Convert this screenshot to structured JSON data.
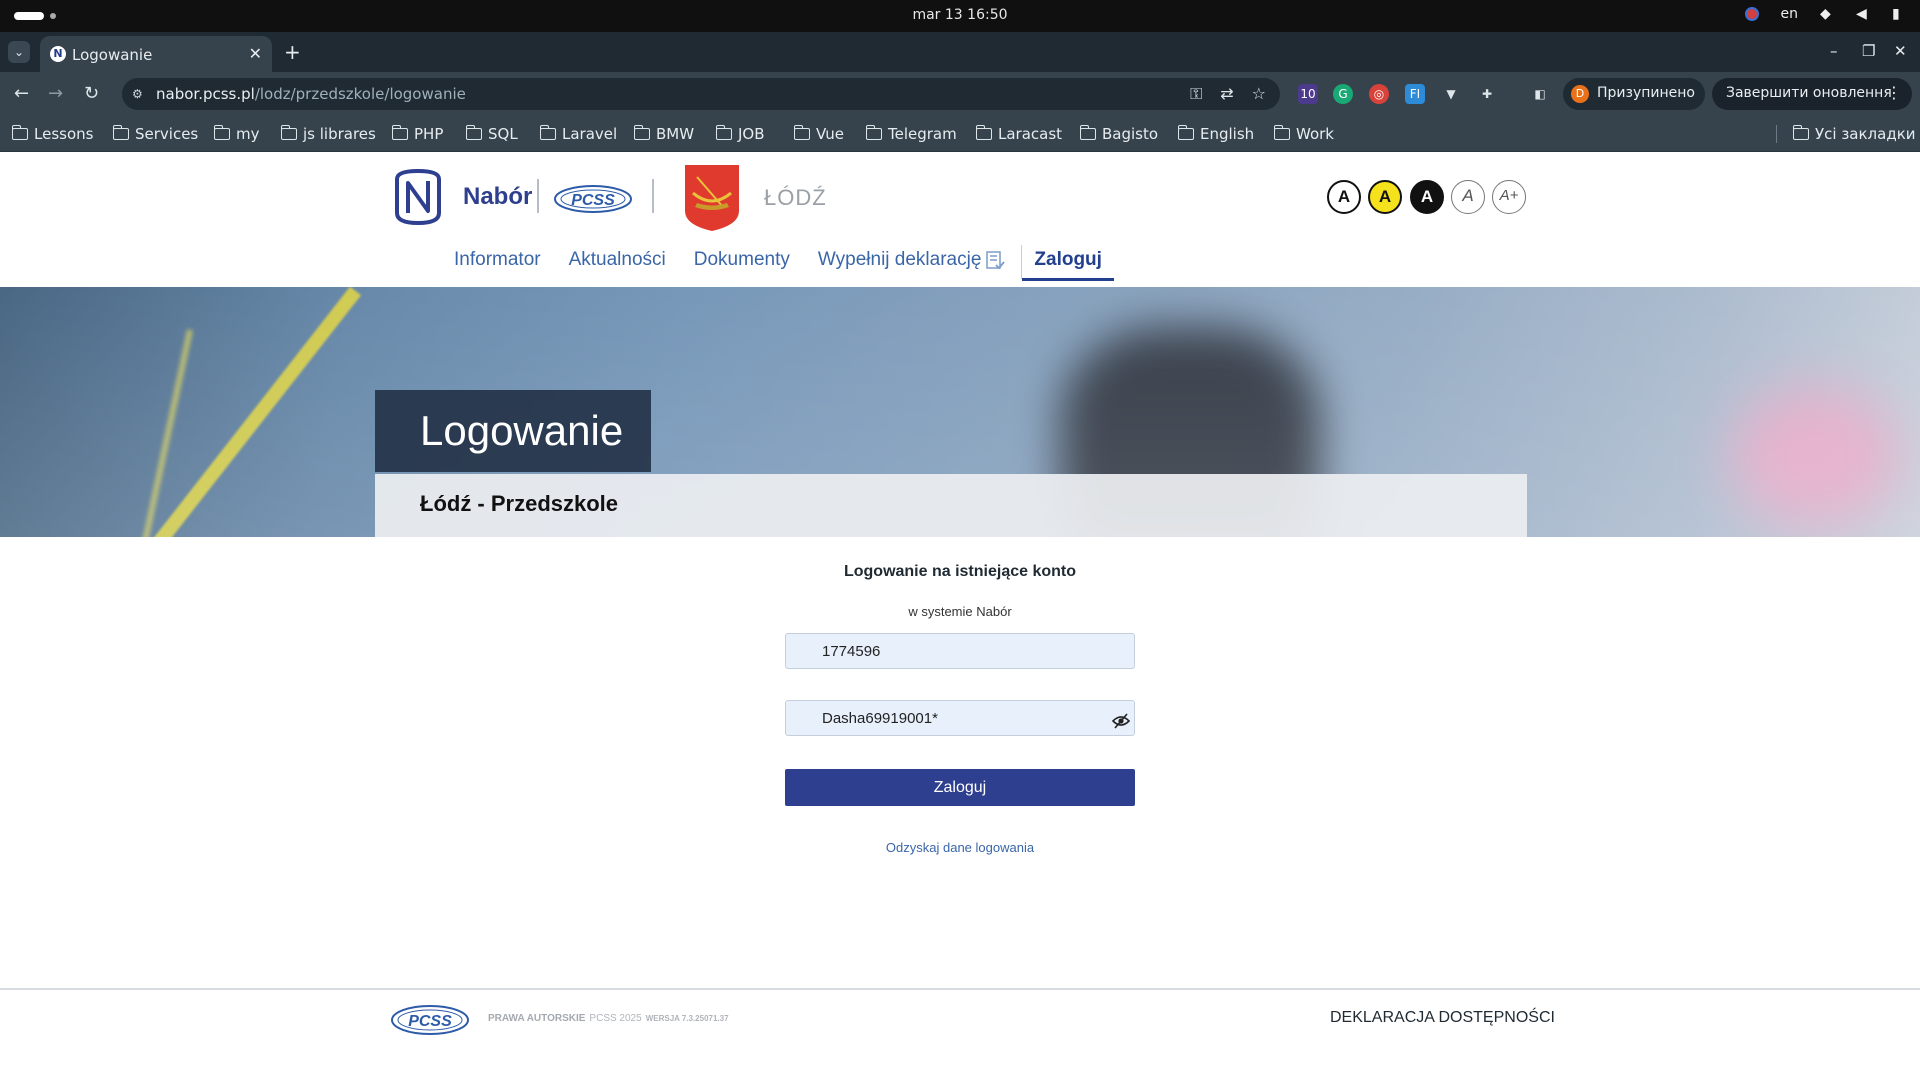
{
  "os": {
    "clock": "mar 13  16:50",
    "lang": "en"
  },
  "browser": {
    "tab_title": "Logowanie",
    "url_host": "nabor.pcss.pl",
    "url_path": "/lodz/przedszkole/logowanie",
    "ext_badge": "10",
    "profile_label": "Призупинено",
    "profile_initial": "D",
    "update_label": "Завершити оновлення",
    "bookmarks": [
      "Lessons",
      "Services",
      "my",
      "js librares",
      "PHP",
      "SQL",
      "Laravel",
      "BMW",
      "JOB",
      "Vue",
      "Telegram",
      "Laracast",
      "Bagisto",
      "English",
      "Work"
    ],
    "all_bookmarks": "Усі закладки"
  },
  "header": {
    "brand": "Nabór",
    "pcss": "PCSS",
    "city": "ŁÓDŹ",
    "contrast_buttons": [
      "A",
      "A",
      "A",
      "A",
      "A+"
    ]
  },
  "nav": {
    "items": [
      "Informator",
      "Aktualności",
      "Dokumenty",
      "Wypełnij deklarację",
      "Zaloguj"
    ],
    "active": "Zaloguj"
  },
  "hero": {
    "title": "Logowanie",
    "subtitle": "Łódź - Przedszkole"
  },
  "login": {
    "heading": "Logowanie na istniejące konto",
    "subheading": "w systemie Nabór",
    "login_value": "1774596",
    "password_value": "Dasha69919001*",
    "submit_label": "Zaloguj",
    "recover_link": "Odzyskaj dane logowania"
  },
  "footer": {
    "rights": "PRAWA AUTORSKIE",
    "copyright": "PCSS 2025",
    "version": "WERSJA 7.3.25071.37",
    "accessibility": "DEKLARACJA DOSTĘPNOŚCI"
  },
  "colors": {
    "brand_navy": "#2d3f8e",
    "link_blue": "#3a66a8",
    "coat_red": "#e03a2f",
    "contrast_yellow": "#f5e11c"
  }
}
